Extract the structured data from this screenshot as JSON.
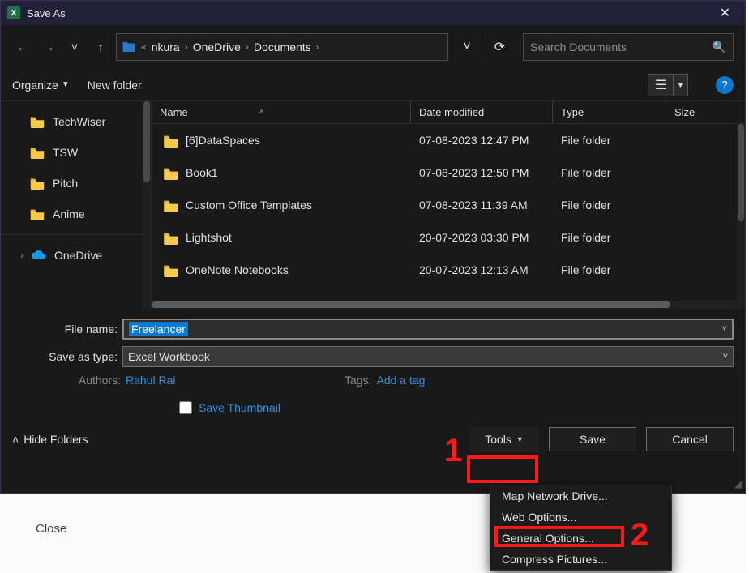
{
  "window": {
    "title": "Save As"
  },
  "breadcrumb": {
    "root_prefix": "«",
    "crumbs": [
      "nkura",
      "OneDrive",
      "Documents"
    ]
  },
  "search": {
    "placeholder": "Search Documents"
  },
  "toolbar": {
    "organize": "Organize",
    "new_folder": "New folder"
  },
  "sidebar": {
    "folders": [
      "TechWiser",
      "TSW",
      "Pitch",
      "Anime"
    ],
    "onedrive": "OneDrive"
  },
  "columns": {
    "name": "Name",
    "date": "Date modified",
    "type": "Type",
    "size": "Size"
  },
  "files": [
    {
      "name": "[6]DataSpaces",
      "date": "07-08-2023 12:47 PM",
      "type": "File folder"
    },
    {
      "name": "Book1",
      "date": "07-08-2023 12:50 PM",
      "type": "File folder"
    },
    {
      "name": "Custom Office Templates",
      "date": "07-08-2023 11:39 AM",
      "type": "File folder"
    },
    {
      "name": "Lightshot",
      "date": "20-07-2023 03:30 PM",
      "type": "File folder"
    },
    {
      "name": "OneNote Notebooks",
      "date": "20-07-2023 12:13 AM",
      "type": "File folder"
    }
  ],
  "form": {
    "filename_label": "File name:",
    "filename_value": "Freelancer",
    "savetype_label": "Save as type:",
    "savetype_value": "Excel Workbook",
    "authors_label": "Authors:",
    "authors_value": "Rahul Rai",
    "tags_label": "Tags:",
    "tags_value": "Add a tag",
    "save_thumbnail": "Save Thumbnail"
  },
  "footer": {
    "hide_folders": "Hide Folders",
    "tools": "Tools",
    "save": "Save",
    "cancel": "Cancel"
  },
  "tools_menu": [
    "Map Network Drive...",
    "Web Options...",
    "General Options...",
    "Compress Pictures..."
  ],
  "background": {
    "close": "Close"
  },
  "annotations": {
    "one": "1",
    "two": "2"
  }
}
